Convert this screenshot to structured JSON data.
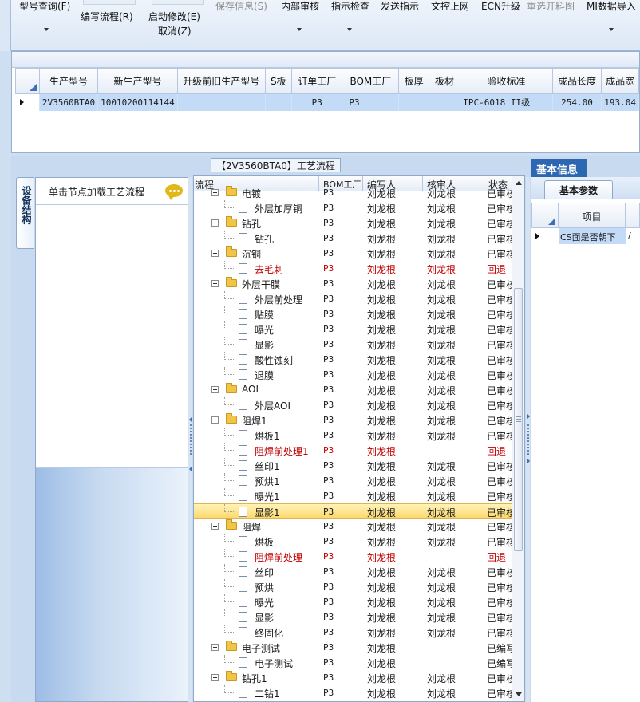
{
  "ribbon": {
    "items": [
      {
        "label": "型号查询(F)",
        "state": "normal"
      },
      {
        "label": "编写流程(R)",
        "state": "normal"
      },
      {
        "label": "启动修改(E)",
        "state": "normal"
      },
      {
        "label": "取消(Z)",
        "state": "normal"
      },
      {
        "label": "保存信息(S)",
        "state": "disabled"
      },
      {
        "label": "内部审核",
        "state": "normal"
      },
      {
        "label": "指示检查",
        "state": "normal"
      },
      {
        "label": "发送指示",
        "state": "normal"
      },
      {
        "label": "文控上网",
        "state": "normal"
      },
      {
        "label": "ECN升级",
        "state": "normal"
      },
      {
        "label": "重选开料图",
        "state": "disabled"
      },
      {
        "label": "MI数据导入",
        "state": "normal"
      }
    ]
  },
  "product_grid": {
    "columns": [
      "生产型号",
      "新生产型号",
      "升级前旧生产型号",
      "S板",
      "订单工厂",
      "BOM工厂",
      "板厚",
      "板材",
      "验收标准",
      "成品长度",
      "成品宽"
    ],
    "rows": [
      [
        "2V3560BTA0",
        "10010200114144",
        "",
        "",
        "P3",
        "P3",
        "",
        "",
        "IPC-6018 II级",
        "254.00",
        "193.04"
      ]
    ]
  },
  "process_panel": {
    "title": "【2V3560BTA0】工艺流程",
    "side_tab": "设备结构",
    "hint": "单击节点加载工艺流程"
  },
  "tree": {
    "columns": [
      "流程",
      "BOM工厂",
      "编写人",
      "核审人",
      "状态"
    ],
    "rows": [
      {
        "level": 0,
        "name": "电镀",
        "bom": "P3",
        "writer": "刘龙根",
        "reviewer": "刘龙根",
        "status": "已审核",
        "red": false,
        "selected": false
      },
      {
        "level": 1,
        "name": "外层加厚铜",
        "bom": "P3",
        "writer": "刘龙根",
        "reviewer": "刘龙根",
        "status": "已审核",
        "red": false,
        "selected": false
      },
      {
        "level": 0,
        "name": "钻孔",
        "bom": "P3",
        "writer": "刘龙根",
        "reviewer": "刘龙根",
        "status": "已审核",
        "red": false,
        "selected": false
      },
      {
        "level": 1,
        "name": "钻孔",
        "bom": "P3",
        "writer": "刘龙根",
        "reviewer": "刘龙根",
        "status": "已审核",
        "red": false,
        "selected": false
      },
      {
        "level": 0,
        "name": "沉铜",
        "bom": "P3",
        "writer": "刘龙根",
        "reviewer": "刘龙根",
        "status": "已审核",
        "red": false,
        "selected": false
      },
      {
        "level": 1,
        "name": "去毛刺",
        "bom": "P3",
        "writer": "刘龙根",
        "reviewer": "刘龙根",
        "status": "回退",
        "red": true,
        "selected": false
      },
      {
        "level": 0,
        "name": "外层干膜",
        "bom": "P3",
        "writer": "刘龙根",
        "reviewer": "刘龙根",
        "status": "已审核",
        "red": false,
        "selected": false
      },
      {
        "level": 1,
        "name": "外层前处理",
        "bom": "P3",
        "writer": "刘龙根",
        "reviewer": "刘龙根",
        "status": "已审核",
        "red": false,
        "selected": false
      },
      {
        "level": 1,
        "name": "贴膜",
        "bom": "P3",
        "writer": "刘龙根",
        "reviewer": "刘龙根",
        "status": "已审核",
        "red": false,
        "selected": false
      },
      {
        "level": 1,
        "name": "曝光",
        "bom": "P3",
        "writer": "刘龙根",
        "reviewer": "刘龙根",
        "status": "已审核",
        "red": false,
        "selected": false
      },
      {
        "level": 1,
        "name": "显影",
        "bom": "P3",
        "writer": "刘龙根",
        "reviewer": "刘龙根",
        "status": "已审核",
        "red": false,
        "selected": false
      },
      {
        "level": 1,
        "name": "酸性蚀刻",
        "bom": "P3",
        "writer": "刘龙根",
        "reviewer": "刘龙根",
        "status": "已审核",
        "red": false,
        "selected": false
      },
      {
        "level": 1,
        "name": "退膜",
        "bom": "P3",
        "writer": "刘龙根",
        "reviewer": "刘龙根",
        "status": "已审核",
        "red": false,
        "selected": false
      },
      {
        "level": 0,
        "name": "AOI",
        "bom": "P3",
        "writer": "刘龙根",
        "reviewer": "刘龙根",
        "status": "已审核",
        "red": false,
        "selected": false
      },
      {
        "level": 1,
        "name": "外层AOI",
        "bom": "P3",
        "writer": "刘龙根",
        "reviewer": "刘龙根",
        "status": "已审核",
        "red": false,
        "selected": false
      },
      {
        "level": 0,
        "name": "阻焊1",
        "bom": "P3",
        "writer": "刘龙根",
        "reviewer": "刘龙根",
        "status": "已审核",
        "red": false,
        "selected": false
      },
      {
        "level": 1,
        "name": "烘板1",
        "bom": "P3",
        "writer": "刘龙根",
        "reviewer": "刘龙根",
        "status": "已审核",
        "red": false,
        "selected": false
      },
      {
        "level": 1,
        "name": "阻焊前处理1",
        "bom": "P3",
        "writer": "刘龙根",
        "reviewer": "",
        "status": "回退",
        "red": true,
        "selected": false
      },
      {
        "level": 1,
        "name": "丝印1",
        "bom": "P3",
        "writer": "刘龙根",
        "reviewer": "刘龙根",
        "status": "已审核",
        "red": false,
        "selected": false
      },
      {
        "level": 1,
        "name": "预烘1",
        "bom": "P3",
        "writer": "刘龙根",
        "reviewer": "刘龙根",
        "status": "已审核",
        "red": false,
        "selected": false
      },
      {
        "level": 1,
        "name": "曝光1",
        "bom": "P3",
        "writer": "刘龙根",
        "reviewer": "刘龙根",
        "status": "已审核",
        "red": false,
        "selected": false
      },
      {
        "level": 1,
        "name": "显影1",
        "bom": "P3",
        "writer": "刘龙根",
        "reviewer": "刘龙根",
        "status": "已审核",
        "red": false,
        "selected": true
      },
      {
        "level": 0,
        "name": "阻焊",
        "bom": "P3",
        "writer": "刘龙根",
        "reviewer": "刘龙根",
        "status": "已审核",
        "red": false,
        "selected": false
      },
      {
        "level": 1,
        "name": "烘板",
        "bom": "P3",
        "writer": "刘龙根",
        "reviewer": "刘龙根",
        "status": "已审核",
        "red": false,
        "selected": false
      },
      {
        "level": 1,
        "name": "阻焊前处理",
        "bom": "P3",
        "writer": "刘龙根",
        "reviewer": "",
        "status": "回退",
        "red": true,
        "selected": false
      },
      {
        "level": 1,
        "name": "丝印",
        "bom": "P3",
        "writer": "刘龙根",
        "reviewer": "刘龙根",
        "status": "已审核",
        "red": false,
        "selected": false
      },
      {
        "level": 1,
        "name": "预烘",
        "bom": "P3",
        "writer": "刘龙根",
        "reviewer": "刘龙根",
        "status": "已审核",
        "red": false,
        "selected": false
      },
      {
        "level": 1,
        "name": "曝光",
        "bom": "P3",
        "writer": "刘龙根",
        "reviewer": "刘龙根",
        "status": "已审核",
        "red": false,
        "selected": false
      },
      {
        "level": 1,
        "name": "显影",
        "bom": "P3",
        "writer": "刘龙根",
        "reviewer": "刘龙根",
        "status": "已审核",
        "red": false,
        "selected": false
      },
      {
        "level": 1,
        "name": "终固化",
        "bom": "P3",
        "writer": "刘龙根",
        "reviewer": "刘龙根",
        "status": "已审核",
        "red": false,
        "selected": false
      },
      {
        "level": 0,
        "name": "电子测试",
        "bom": "P3",
        "writer": "刘龙根",
        "reviewer": "",
        "status": "已编写",
        "red": false,
        "selected": false
      },
      {
        "level": 1,
        "name": "电子测试",
        "bom": "P3",
        "writer": "刘龙根",
        "reviewer": "",
        "status": "已编写",
        "red": false,
        "selected": false
      },
      {
        "level": 0,
        "name": "钻孔1",
        "bom": "P3",
        "writer": "刘龙根",
        "reviewer": "刘龙根",
        "status": "已审核",
        "red": false,
        "selected": false
      },
      {
        "level": 1,
        "name": "二钻1",
        "bom": "P3",
        "writer": "刘龙根",
        "reviewer": "刘龙根",
        "status": "已审核",
        "red": false,
        "selected": false
      }
    ]
  },
  "right_panel": {
    "tab": "基本信息",
    "subtab": "基本参数",
    "column": "项目",
    "row_label": "CS面是否朝下",
    "row_value": "/"
  },
  "colors": {
    "accent": "#2c67b1",
    "selection": "#fbd970",
    "red_text": "#c00000",
    "grid_row": "#c3dbf7"
  }
}
